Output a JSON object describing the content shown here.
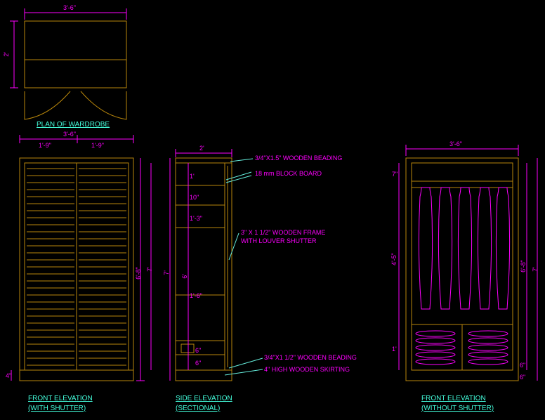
{
  "plan": {
    "dim_top": "3'-6\"",
    "title": "PLAN OF WARDROBE",
    "dim_left": "2'"
  },
  "front_shutter": {
    "dim_overall": "3'-6\"",
    "dim_half_left": "1'-9\"",
    "dim_half_right": "1'-9\"",
    "dim_height_outer": "7'",
    "dim_height_inner": "6'-8\"",
    "dim_bottom": "4\"",
    "title_l1": "FRONT ELEVATION",
    "title_l2": "(WITH SHUTTER)"
  },
  "side": {
    "dim_top": "2'",
    "dim_a": "1'",
    "dim_b": "10\"",
    "dim_c": "1'-3\"",
    "dim_shelf": "1'-6\"",
    "dim_hanging": "6'",
    "dim_bottom1": "6\"",
    "dim_bottom2": "6\"",
    "dim_overall": "7'",
    "note_beading1": "3/4\"X1.5\" WOODEN BEADING",
    "note_block": "18 mm BLOCK BOARD",
    "note_frame_l1": "3\" X 1 1/2\" WOODEN FRAME",
    "note_frame_l2": "WITH LOUVER SHUTTER",
    "note_beading2": "3/4\"X1 1/2\" WOODEN BEADING",
    "note_skirting": "4\" HIGH WOODEN SKIRTING",
    "title_l1": "SIDE ELEVATION",
    "title_l2": "(SECTIONAL)"
  },
  "front_open": {
    "dim_overall": "3'-6\"",
    "dim_top": "7\"",
    "dim_hanging": "4'-5\"",
    "dim_drawer": "1'",
    "dim_total": "6'-8\"",
    "dim_bottom1": "6\"",
    "dim_bottom2": "6\"",
    "dim_overall_right": "7'",
    "title_l1": "FRONT ELEVATION",
    "title_l2": "(WITHOUT SHUTTER)"
  }
}
